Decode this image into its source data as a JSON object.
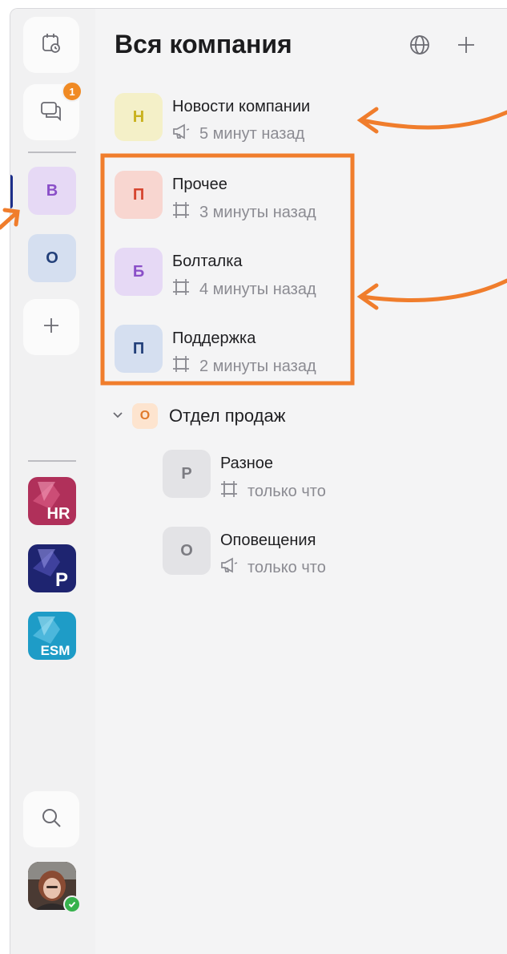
{
  "header": {
    "title": "Вся компания",
    "globe_icon": "globe-icon",
    "add_icon": "plus-icon"
  },
  "rail": {
    "calendar_icon": "calendar-clock-icon",
    "chats_icon": "chats-icon",
    "chats_badge": "1",
    "workspaces": [
      {
        "letter": "В",
        "bg": "#e6d9f5",
        "fg": "#8a4fc8",
        "active": true
      },
      {
        "letter": "О",
        "bg": "#d5dff0",
        "fg": "#23407a",
        "active": false
      }
    ],
    "add_workspace_icon": "plus-icon",
    "apps": [
      {
        "label": "HR",
        "color": "#b0305a"
      },
      {
        "label": "P",
        "color": "#1e2470"
      },
      {
        "label": "ESM",
        "color": "#1e9cc7"
      }
    ],
    "search_icon": "search-icon"
  },
  "channels": [
    {
      "letter": "Н",
      "name": "Новости компании",
      "time": "5 минут назад",
      "icon": "megaphone-icon",
      "bg": "#f4f0c8",
      "fg": "#c9b21e"
    },
    {
      "letter": "П",
      "name": "Прочее",
      "time": "3 минуты назад",
      "icon": "hash-icon",
      "bg": "#f8d6d0",
      "fg": "#d6452f"
    },
    {
      "letter": "Б",
      "name": "Болталка",
      "time": "4 минуты назад",
      "icon": "hash-icon",
      "bg": "#e6d9f5",
      "fg": "#8a4fc8"
    },
    {
      "letter": "П",
      "name": "Поддержка",
      "time": "2 минуты назад",
      "icon": "hash-icon",
      "bg": "#d5dff0",
      "fg": "#23407a"
    }
  ],
  "group": {
    "letter": "О",
    "name": "Отдел продаж",
    "channels": [
      {
        "letter": "Р",
        "name": "Разное",
        "time": "только что",
        "icon": "hash-icon",
        "bg": "#e3e3e6",
        "fg": "#7c7c82"
      },
      {
        "letter": "О",
        "name": "Оповещения",
        "time": "только что",
        "icon": "megaphone-icon",
        "bg": "#e3e3e6",
        "fg": "#7c7c82"
      }
    ]
  },
  "colors": {
    "annotation": "#f07d2c",
    "accent": "#1d2f8a",
    "badge": "#f08a24",
    "online": "#37b24d"
  }
}
